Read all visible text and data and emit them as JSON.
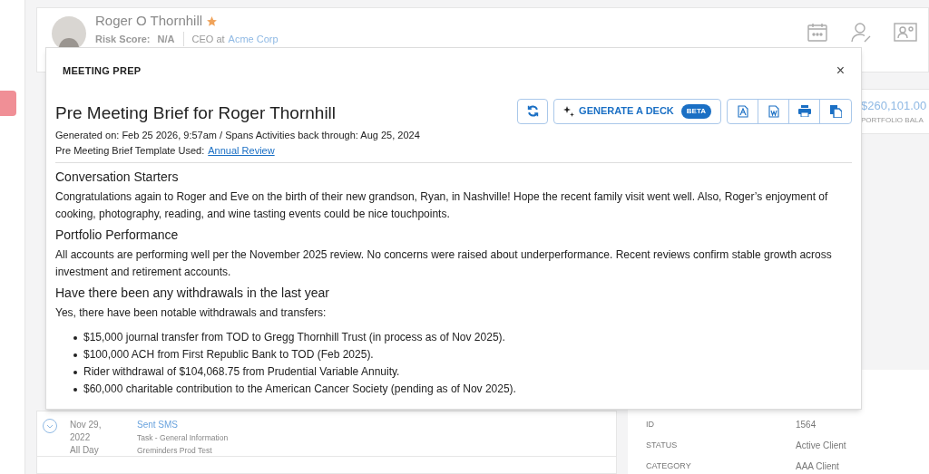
{
  "profile": {
    "name": "Roger O Thornhill",
    "favorite": true,
    "risk_label": "Risk Score:",
    "risk_value": "N/A",
    "role": "CEO at",
    "company": "Acme Corp"
  },
  "summary": {
    "amount": "$260,101.00",
    "label": "PORTFOLIO BALA"
  },
  "modal": {
    "title": "MEETING PREP",
    "close": "×",
    "brief_title": "Pre Meeting Brief for Roger Thornhill",
    "generated": "Generated on: Feb 25 2026, 9:57am / Spans Activities back through: Aug 25, 2024",
    "template_label": "Pre Meeting Brief Template Used:",
    "template_link": "Annual Review",
    "deck_label": "GENERATE A DECK",
    "deck_badge": "BETA",
    "sections": [
      {
        "heading": "Conversation Starters",
        "paragraphs": [
          "Congratulations again to Roger and Eve on the birth of their new grandson, Ryan, in Nashville! Hope the recent family visit went well. Also, Roger’s enjoyment of cooking, photography, reading, and wine tasting events could be nice touchpoints."
        ]
      },
      {
        "heading": "Portfolio Performance",
        "paragraphs": [
          "All accounts are performing well per the November 2025 review. No concerns were raised about underperformance. Recent reviews confirm stable growth across investment and retirement accounts."
        ]
      },
      {
        "heading": "Have there been any withdrawals in the last year",
        "paragraphs": [
          "Yes, there have been notable withdrawals and transfers:"
        ],
        "bullets": [
          "$15,000 journal transfer from TOD to Gregg Thornhill Trust (in process as of Nov 2025).",
          "$100,000 ACH from First Republic Bank to TOD (Feb 2025).",
          "Rider withdrawal of $104,068.75 from Prudential Variable Annuity.",
          "$60,000 charitable contribution to the American Cancer Society (pending as of Nov 2025)."
        ]
      }
    ]
  },
  "activities": [
    {
      "date": "Nov 29,",
      "year": "2022",
      "time": "All Day",
      "type": "Sent SMS",
      "detail": "Task - General Information",
      "source": "Greminders Prod Test"
    }
  ],
  "details": [
    {
      "label": "ID",
      "value": "1564"
    },
    {
      "label": "STATUS",
      "value": "Active Client"
    },
    {
      "label": "CATEGORY",
      "value": "AAA Client"
    }
  ]
}
